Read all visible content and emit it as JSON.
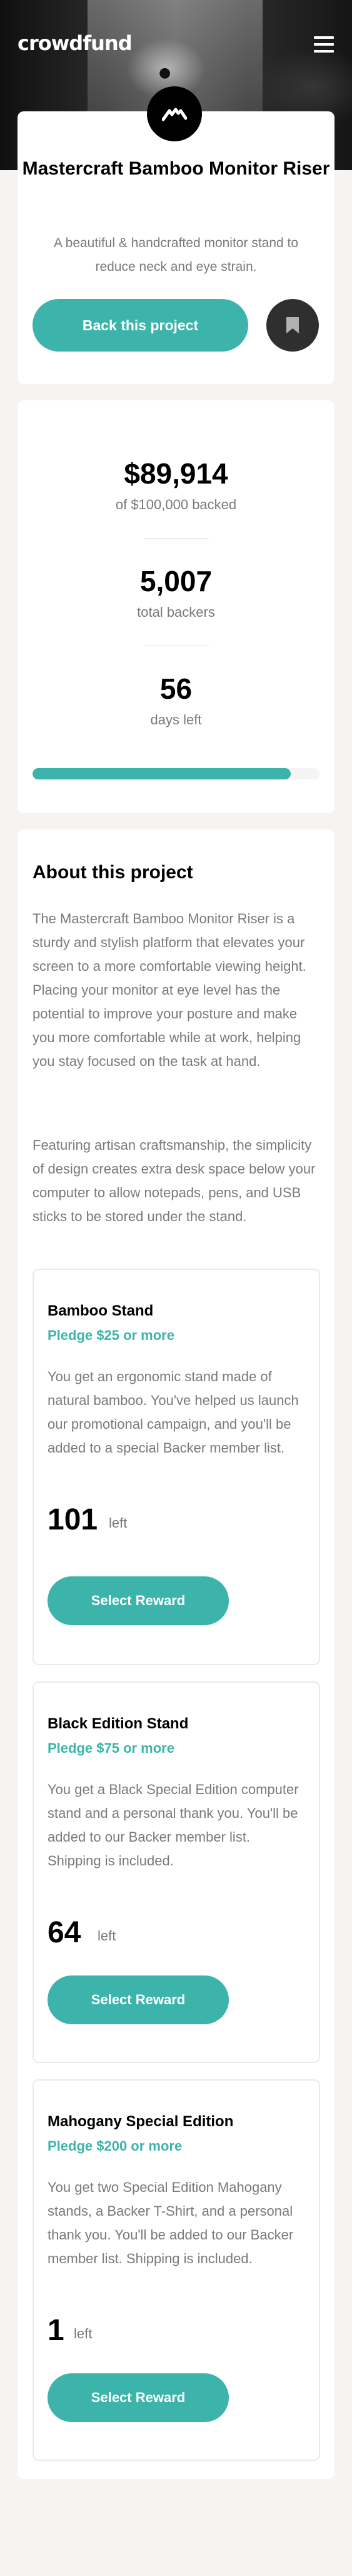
{
  "header": {
    "logo": "crowdfund"
  },
  "intro": {
    "title": "Mastercraft Bamboo Monitor Riser",
    "description": "A beautiful & handcrafted monitor stand to reduce neck and eye strain.",
    "back_button": "Back this project"
  },
  "stats": {
    "backed_amount": "$89,914",
    "backed_label": "of $100,000 backed",
    "backers": "5,007",
    "backers_label": "total backers",
    "days": "56",
    "days_label": "days left",
    "progress_percent": 89.9
  },
  "about": {
    "title": "About this project",
    "paragraph_1": "The Mastercraft Bamboo Monitor Riser is a sturdy and stylish platform that elevates your screen to a more comfortable viewing height. Placing your monitor at eye level has the potential to improve your posture and make you more comfortable while at work, helping you stay focused on the task at hand.",
    "paragraph_2": "Featuring artisan craftsmanship, the simplicity of design creates extra desk space below your computer to allow notepads, pens, and USB sticks to be stored under the stand.",
    "rewards": [
      {
        "name": "Bamboo Stand",
        "pledge": "Pledge $25 or more",
        "description": "You get an ergonomic stand made of natural bamboo. You've helped us launch our promotional campaign, and you'll be added to a special Backer member list.",
        "count": "101",
        "left_label": "left",
        "button": "Select Reward"
      },
      {
        "name": "Black Edition Stand",
        "pledge": "Pledge $75 or more",
        "description": "You get a Black Special Edition computer stand and a personal thank you. You'll be added to our Backer member list. Shipping is included.",
        "count": "64",
        "left_label": "left",
        "button": "Select Reward"
      },
      {
        "name": "Mahogany Special Edition",
        "pledge": "Pledge $200 or more",
        "description": "You get two Special Edition Mahogany stands, a Backer T-Shirt, and a personal thank you. You'll be added to our Backer member list. Shipping is included.",
        "count": "1",
        "left_label": "left",
        "button": "Select Reward"
      }
    ]
  },
  "colors": {
    "accent": "#3cb4ac",
    "dark": "#2f2f2f",
    "text_muted": "#7a7a7a",
    "background": "#f5f4f2"
  },
  "icons": {
    "menu": "hamburger-menu-icon",
    "brand": "mastercraft-logo-icon",
    "bookmark": "bookmark-icon"
  }
}
